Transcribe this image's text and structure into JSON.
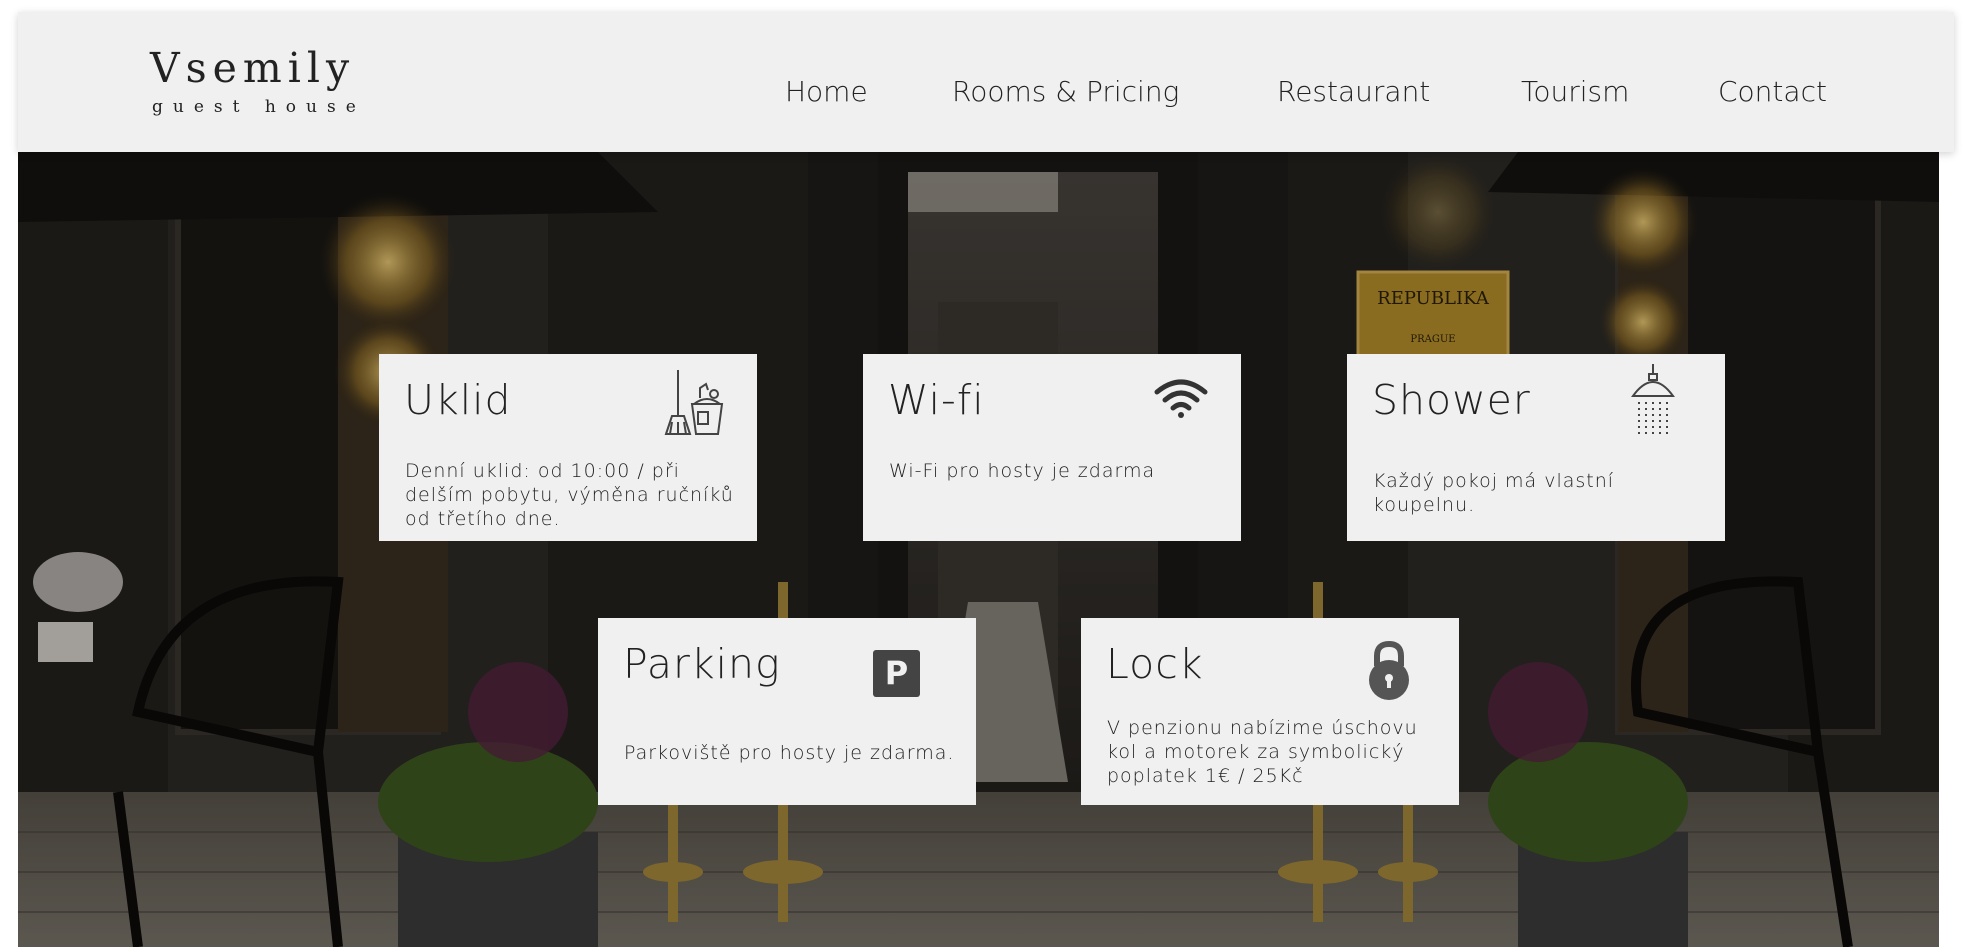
{
  "logo": {
    "title": "Vsemily",
    "subtitle": "guest house"
  },
  "nav": {
    "home": "Home",
    "rooms": "Rooms & Pricing",
    "restaurant": "Restaurant",
    "tourism": "Tourism",
    "contact": "Contact"
  },
  "hero": {
    "sign_text": "REPUBLIKA",
    "sign_sub": "PRAGUE"
  },
  "features": {
    "uklid": {
      "title": "Uklid",
      "text": "Denní uklid: od 10:00 / při delším pobytu, výměna ručníků od třetího dne.",
      "icon": "broom-bucket-icon"
    },
    "wifi": {
      "title": "Wi-fi",
      "text": "Wi-Fi pro hosty je zdarma",
      "icon": "wifi-icon"
    },
    "shower": {
      "title": "Shower",
      "text": "Každý pokoj má vlastní koupelnu.",
      "icon": "shower-icon"
    },
    "parking": {
      "title": "Parking",
      "text": "Parkoviště pro hosty je zdarma.",
      "icon": "parking-icon",
      "icon_letter": "P"
    },
    "lock": {
      "title": "Lock",
      "text": "V penzionu nabízime úschovu kol a motorek za symbolický poplatek 1€ / 25Kč",
      "icon": "lock-icon"
    }
  }
}
